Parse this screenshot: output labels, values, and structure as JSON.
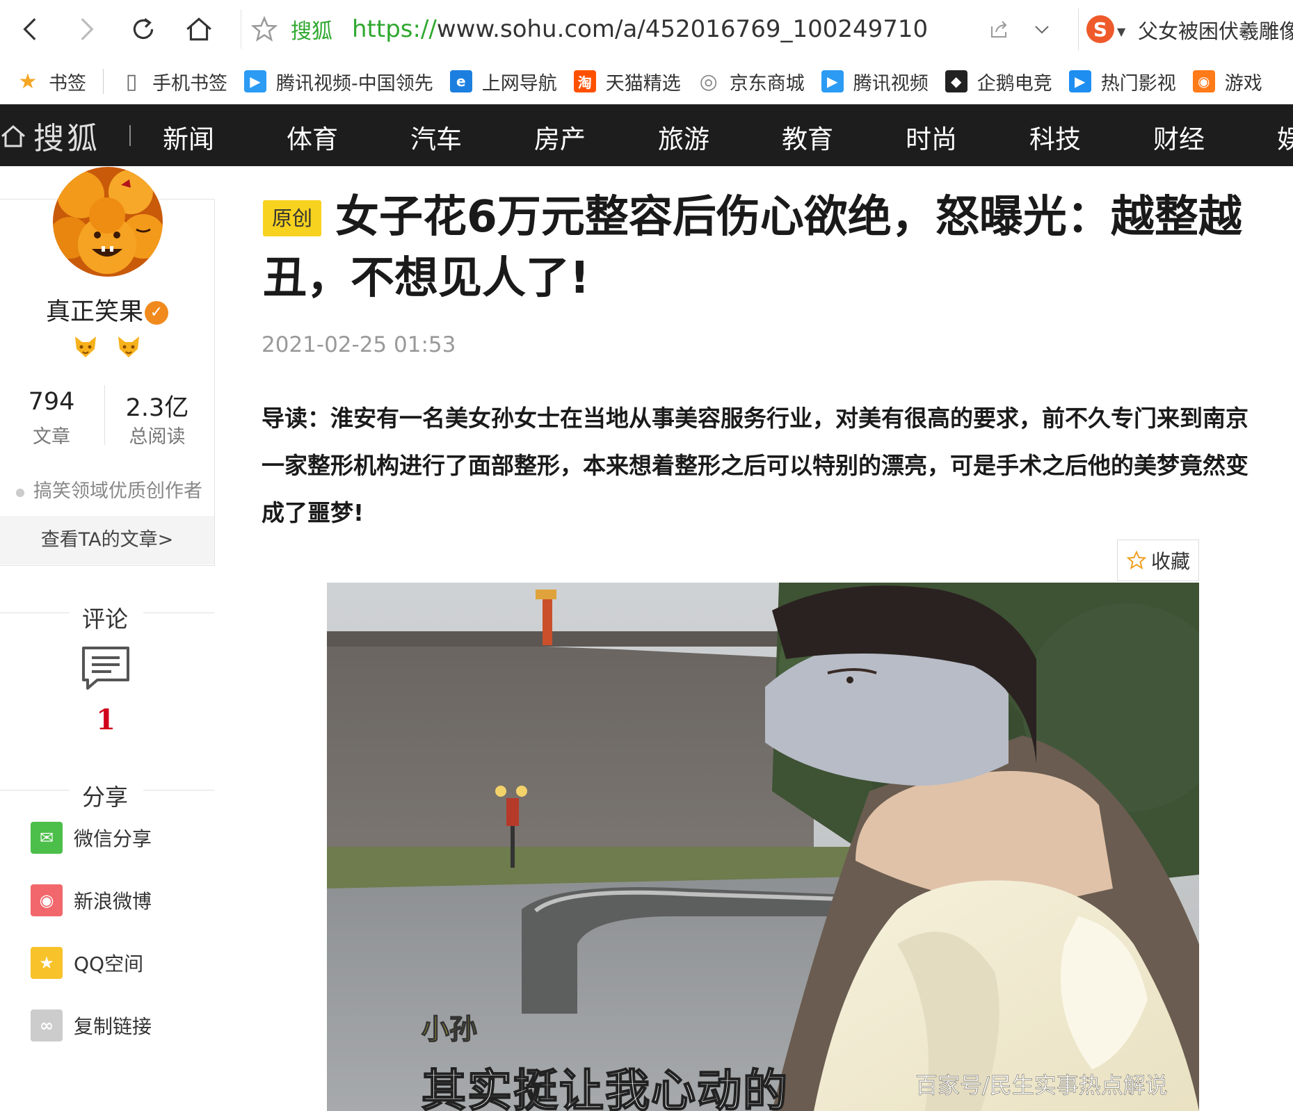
{
  "browser": {
    "site_name": "搜狐",
    "url_protocol": "https://",
    "url_rest": "www.sohu.com/a/452016769_100249710",
    "search_hint": "父女被困伏羲雕像"
  },
  "bookmarks": [
    {
      "label": "书签",
      "icon": "star-icon",
      "color": "#f5a623"
    },
    {
      "label": "手机书签",
      "icon": "phone-icon",
      "color": "#666666"
    },
    {
      "label": "腾讯视频-中国领先",
      "icon": "tencent-video-icon",
      "color": "#2b9bf4"
    },
    {
      "label": "上网导航",
      "icon": "ie-icon",
      "color": "#1c7fe0"
    },
    {
      "label": "天猫精选",
      "icon": "taobao-icon",
      "color": "#ff5000"
    },
    {
      "label": "京东商城",
      "icon": "globe-icon",
      "color": "#888888"
    },
    {
      "label": "腾讯视频",
      "icon": "tencent-video-icon",
      "color": "#2b9bf4"
    },
    {
      "label": "企鹅电竞",
      "icon": "penguin-icon",
      "color": "#222222"
    },
    {
      "label": "热门影视",
      "icon": "play-icon",
      "color": "#1f8ef1"
    },
    {
      "label": "游戏",
      "icon": "gamepad-icon",
      "color": "#ff7a18"
    }
  ],
  "sohu_nav": {
    "logo": "搜狐",
    "items": [
      "新闻",
      "体育",
      "汽车",
      "房产",
      "旅游",
      "教育",
      "时尚",
      "科技",
      "财经",
      "娱"
    ]
  },
  "author": {
    "name": "真正笑果",
    "articles_count": "794",
    "articles_label": "文章",
    "reads_count": "2.3亿",
    "reads_label": "总阅读",
    "tag": "搞笑领域优质创作者",
    "view_link": "查看TA的文章>"
  },
  "comments": {
    "title": "评论",
    "count": "1"
  },
  "share": {
    "title": "分享",
    "items": [
      {
        "label": "微信分享",
        "icon": "wechat-icon",
        "color": "#4cbe4a"
      },
      {
        "label": "新浪微博",
        "icon": "weibo-icon",
        "color": "#f1676b"
      },
      {
        "label": "QQ空间",
        "icon": "qzone-icon",
        "color": "#f7c22a"
      },
      {
        "label": "复制链接",
        "icon": "link-icon",
        "color": "#cccccc"
      }
    ]
  },
  "article": {
    "badge": "原创",
    "title": "女子花6万元整容后伤心欲绝，怒曝光：越整越丑，不想见人了!",
    "time": "2021-02-25 01:53",
    "intro": "导读：淮安有一名美女孙女士在当地从事美容服务行业，对美有很高的要求，前不久专门来到南京一家整形机构进行了面部整形，本来想着整形之后可以特别的漂亮，可是手术之后他的美梦竟然变成了噩梦!",
    "favorite": "收藏",
    "photo_subtitle_name": "小孙",
    "photo_subtitle": "其实挺让我心动的",
    "photo_watermark": "百家号/民生实事热点解说"
  }
}
